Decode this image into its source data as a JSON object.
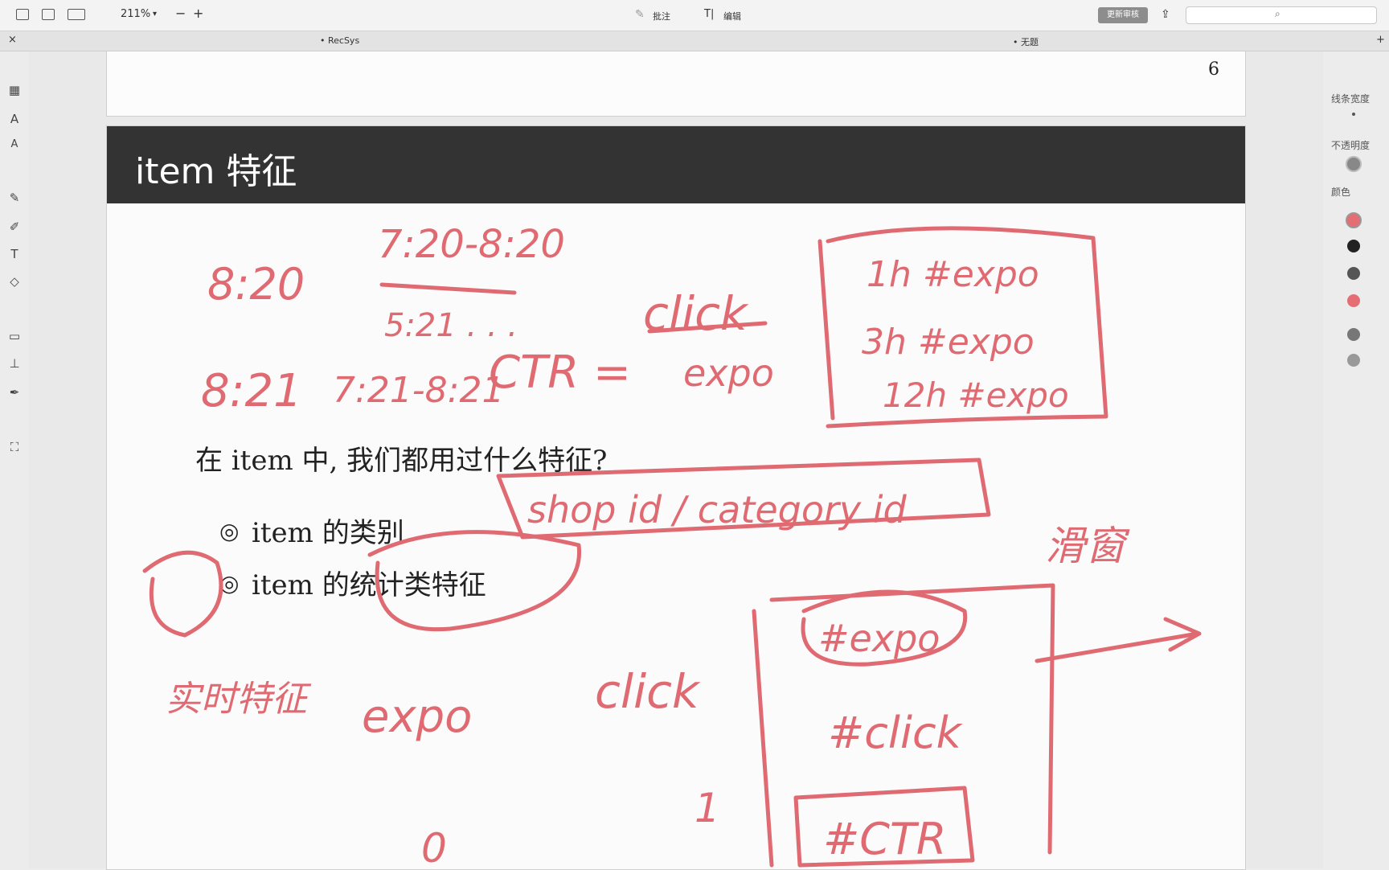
{
  "toolbar": {
    "zoom": "211%",
    "zoom_out": "−",
    "zoom_in": "+",
    "annotate_label": "批注",
    "edit_label": "编辑",
    "update_button": "更新审核"
  },
  "tabs": {
    "active": "• RecSys",
    "second": "• 无题",
    "close": "×",
    "add": "+"
  },
  "right_panel": {
    "line_width_label": "线条宽度",
    "opacity_label": "不透明度",
    "color_label": "颜色",
    "colors": [
      "#e46e74",
      "#222222",
      "#555555",
      "#e46e74",
      "#777777",
      "#999999"
    ]
  },
  "document": {
    "prev_page_number": "6",
    "frame_title": "item 特征",
    "question": "在 item 中, 我们都用过什么特征?",
    "bullets": [
      {
        "marker": "◎",
        "text": "item 的类别"
      },
      {
        "marker": "◎",
        "text": "item 的统计类特征"
      }
    ]
  },
  "handwriting": {
    "ink_color": "#e06a72",
    "notes": [
      "8:20",
      "7:20-8:20",
      "5:21 . . .",
      "8:21",
      "7:21-8:21",
      "CTR =",
      "click",
      "expo",
      "1h #expo",
      "3h #expo",
      "12h #expo",
      "shop id / category id",
      "滑窗",
      "实时特征",
      "expo",
      "click",
      "#expo",
      "#click",
      "#CTR",
      "0",
      "1"
    ]
  }
}
